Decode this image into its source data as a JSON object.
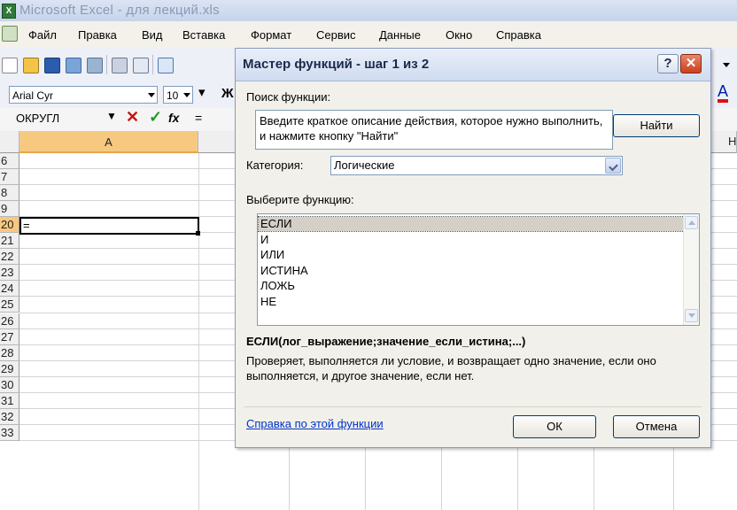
{
  "app": {
    "title": "Microsoft Excel - для лекций.xls"
  },
  "menu": [
    {
      "label": "Файл",
      "accel": "Ф"
    },
    {
      "label": "Правка",
      "accel": "П"
    },
    {
      "label": "Вид",
      "accel": "В"
    },
    {
      "label": "Вставка",
      "accel": "а"
    },
    {
      "label": "Формат",
      "accel": "м"
    },
    {
      "label": "Сервис",
      "accel": "е"
    },
    {
      "label": "Данные",
      "accel": "Д"
    },
    {
      "label": "Окно",
      "accel": "О"
    },
    {
      "label": "Справка",
      "accel": "С"
    }
  ],
  "toolbar": {
    "font_name": "Arial Cyr",
    "font_size": "10",
    "bold_label": "Ж",
    "font_color_label": "A"
  },
  "formula_bar": {
    "name_box": "ОКРУГЛ",
    "cancel": "✕",
    "enter": "✓",
    "fx": "fx",
    "content": "="
  },
  "sheet": {
    "columns": [
      {
        "label": "A"
      },
      {
        "label": "Н"
      }
    ],
    "rows": [
      "6",
      "7",
      "8",
      "9",
      "20",
      "21",
      "22",
      "23",
      "24",
      "25",
      "26",
      "27",
      "28",
      "29",
      "30",
      "31",
      "32",
      "33"
    ],
    "active_cell_value": "="
  },
  "dialog": {
    "title": "Мастер функций - шаг 1 из 2",
    "help_btn": "?",
    "close_btn": "✕",
    "search_label": "Поиск функции:",
    "search_text": "Введите краткое описание действия, которое нужно выполнить, и нажмите кнопку \"Найти\"",
    "find_button": "Найти",
    "category_label": "Категория:",
    "category_value": "Логические",
    "choose_label": "Выберите функцию:",
    "functions": [
      "ЕСЛИ",
      "И",
      "ИЛИ",
      "ИСТИНА",
      "ЛОЖЬ",
      "НЕ"
    ],
    "selected_index": 0,
    "signature": "ЕСЛИ(лог_выражение;значение_если_истина;...)",
    "description": "Проверяет, выполняется ли условие, и возвращает одно значение, если оно выполняется, и другое значение, если нет.",
    "help_link": "Справка по этой функции",
    "ok_button": "ОК",
    "cancel_button": "Отмена"
  }
}
